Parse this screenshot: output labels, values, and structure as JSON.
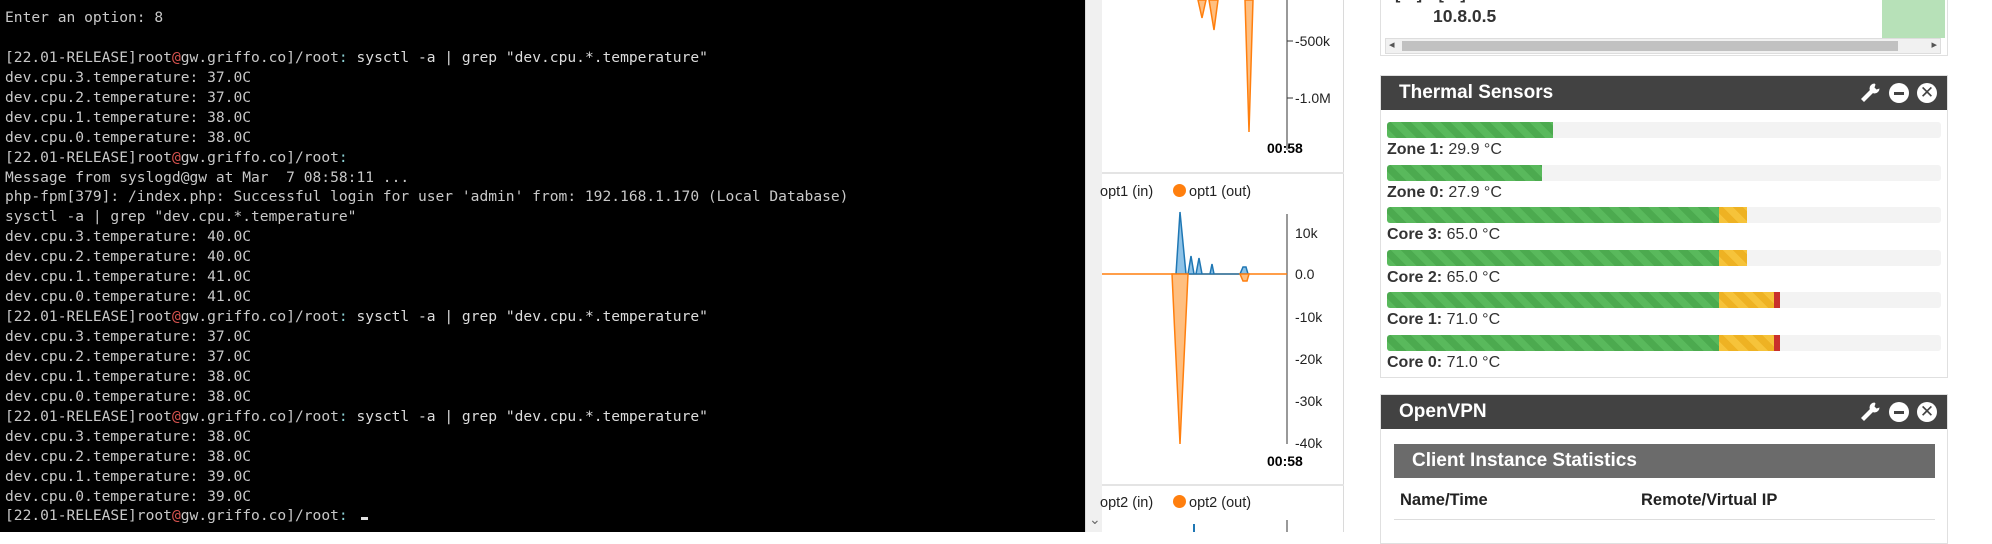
{
  "terminal": {
    "lines": [
      {
        "text": "Enter an option: 8"
      },
      {
        "text": ""
      },
      {
        "prompt": true,
        "command": "sysctl -a | grep \"dev.cpu.*.temperature\""
      },
      {
        "text": "dev.cpu.3.temperature: 37.0C"
      },
      {
        "text": "dev.cpu.2.temperature: 37.0C"
      },
      {
        "text": "dev.cpu.1.temperature: 38.0C"
      },
      {
        "text": "dev.cpu.0.temperature: 38.0C"
      },
      {
        "prompt": true,
        "command": ""
      },
      {
        "text": "Message from syslogd@gw at Mar  7 08:58:11 ..."
      },
      {
        "text": "php-fpm[379]: /index.php: Successful login for user 'admin' from: 192.168.1.170 (Local Database)"
      },
      {
        "text": "sysctl -a | grep \"dev.cpu.*.temperature\""
      },
      {
        "text": "dev.cpu.3.temperature: 40.0C"
      },
      {
        "text": "dev.cpu.2.temperature: 40.0C"
      },
      {
        "text": "dev.cpu.1.temperature: 41.0C"
      },
      {
        "text": "dev.cpu.0.temperature: 41.0C"
      },
      {
        "prompt": true,
        "command": "sysctl -a | grep \"dev.cpu.*.temperature\""
      },
      {
        "text": "dev.cpu.3.temperature: 37.0C"
      },
      {
        "text": "dev.cpu.2.temperature: 37.0C"
      },
      {
        "text": "dev.cpu.1.temperature: 38.0C"
      },
      {
        "text": "dev.cpu.0.temperature: 38.0C"
      },
      {
        "prompt": true,
        "command": "sysctl -a | grep \"dev.cpu.*.temperature\""
      },
      {
        "text": "dev.cpu.3.temperature: 38.0C"
      },
      {
        "text": "dev.cpu.2.temperature: 38.0C"
      },
      {
        "text": "dev.cpu.1.temperature: 39.0C"
      },
      {
        "text": "dev.cpu.0.temperature: 39.0C"
      },
      {
        "prompt": true,
        "command": "",
        "cursor": true
      }
    ],
    "prompt_parts": {
      "release": "[22.01-RELEASE]",
      "user": "root",
      "host": "gw.griffo.co",
      "path": "/root",
      "sep": ": "
    }
  },
  "graphs": {
    "panel1": {
      "ticks": [
        "-500k",
        "-1.0M"
      ],
      "time": "00:58"
    },
    "panel2": {
      "legend_in": "opt1 (in)",
      "legend_out": "opt1 (out)",
      "ticks": [
        "10k",
        "0.0",
        "-10k",
        "-20k",
        "-30k",
        "-40k"
      ],
      "time": "00:58"
    },
    "panel3": {
      "legend_in": "opt2 (in)",
      "legend_out": "opt2 (out)"
    }
  },
  "vpn_top": {
    "ip": "10.8.0.5",
    "glyphs": "[ ] [ ]"
  },
  "thermal": {
    "title": "Thermal Sensors",
    "sensors": [
      {
        "name": "Zone 1:",
        "value": "29.9 °C",
        "green": 0.3,
        "yellow": 0,
        "red": 0
      },
      {
        "name": "Zone 0:",
        "value": "27.9 °C",
        "green": 0.28,
        "yellow": 0,
        "red": 0
      },
      {
        "name": "Core 3:",
        "value": "65.0 °C",
        "green": 0.6,
        "yellow": 0.05,
        "red": 0
      },
      {
        "name": "Core 2:",
        "value": "65.0 °C",
        "green": 0.6,
        "yellow": 0.05,
        "red": 0
      },
      {
        "name": "Core 1:",
        "value": "71.0 °C",
        "green": 0.6,
        "yellow": 0.1,
        "red": 0.01
      },
      {
        "name": "Core 0:",
        "value": "71.0 °C",
        "green": 0.6,
        "yellow": 0.1,
        "red": 0.01
      }
    ]
  },
  "openvpn": {
    "title": "OpenVPN",
    "section_title": "Client Instance Statistics",
    "columns": [
      "Name/Time",
      "Remote/Virtual IP"
    ]
  },
  "colors": {
    "in_series": "#1f77b4",
    "out_series": "#ff7f0e",
    "prompt_user": "#d7d7d7",
    "header_bg": "#424242"
  }
}
